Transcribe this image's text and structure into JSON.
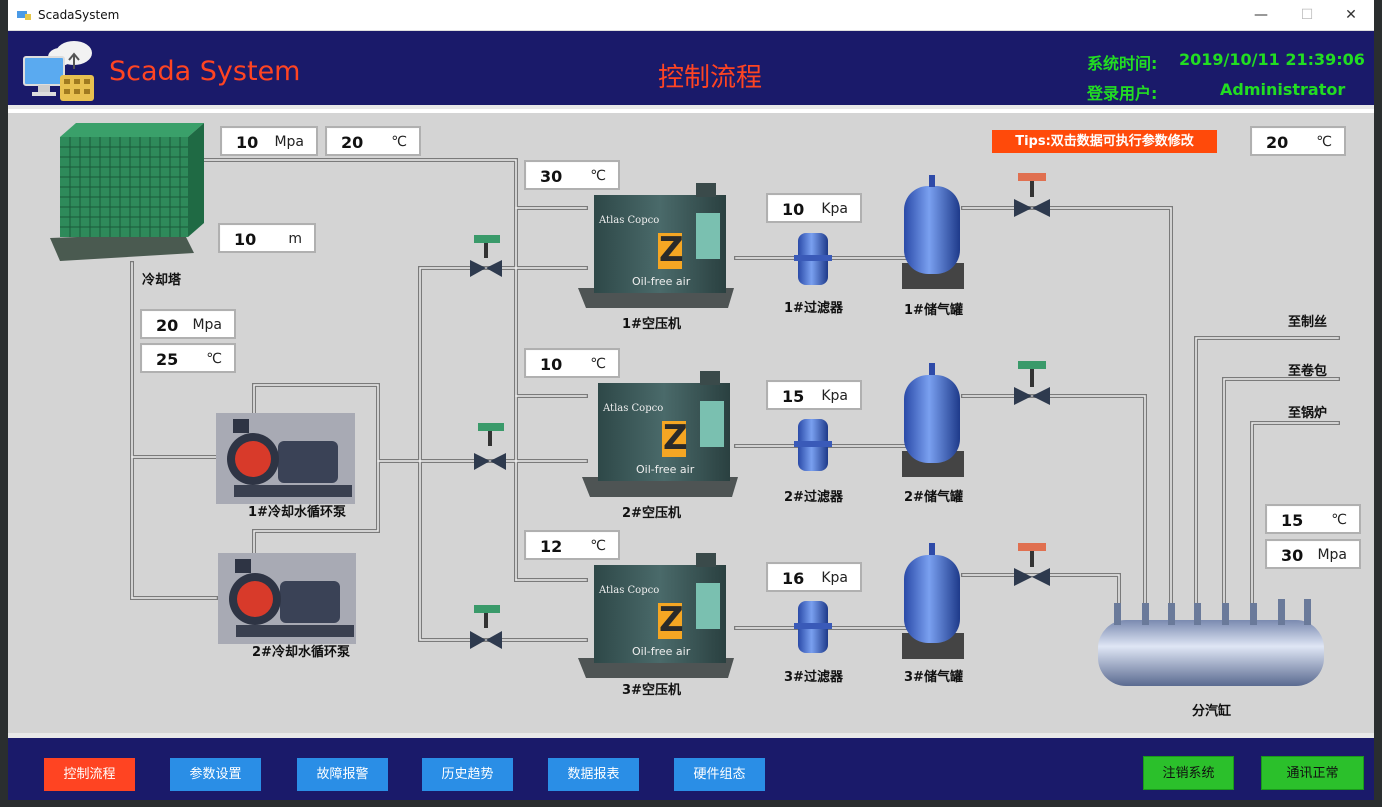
{
  "window": {
    "title": "ScadaSystem",
    "minimize": "—",
    "maximize": "☐",
    "close": "✕"
  },
  "header": {
    "app_name": "Scada System",
    "page_title": "控制流程",
    "time_label": "系统时间:",
    "time_value": "2019/10/11  21:39:06",
    "user_label": "登录用户:",
    "user_value": "Administrator"
  },
  "tips": "Tips:双击数据可执行参数修改",
  "cooling_tower": {
    "label": "冷却塔",
    "pressure": {
      "value": "10",
      "unit": "Mpa"
    },
    "temp": {
      "value": "20",
      "unit": "℃"
    },
    "level": {
      "value": "10",
      "unit": "m"
    }
  },
  "pump_inlet": {
    "pressure": {
      "value": "20",
      "unit": "Mpa"
    },
    "temp": {
      "value": "25",
      "unit": "℃"
    }
  },
  "pumps": [
    {
      "label": "1#冷却水循环泵"
    },
    {
      "label": "2#冷却水循环泵"
    }
  ],
  "compressors": [
    {
      "label": "1#空压机",
      "temp": {
        "value": "30",
        "unit": "℃"
      },
      "brand": "Atlas Copco",
      "badge": "Z",
      "tag": "Oil-free air"
    },
    {
      "label": "2#空压机",
      "temp": {
        "value": "10",
        "unit": "℃"
      },
      "brand": "Atlas Copco",
      "badge": "Z",
      "tag": "Oil-free air"
    },
    {
      "label": "3#空压机",
      "temp": {
        "value": "12",
        "unit": "℃"
      },
      "brand": "Atlas Copco",
      "badge": "Z",
      "tag": "Oil-free air"
    }
  ],
  "filters": [
    {
      "label": "1#过滤器",
      "pressure": {
        "value": "10",
        "unit": "Kpa"
      }
    },
    {
      "label": "2#过滤器",
      "pressure": {
        "value": "15",
        "unit": "Kpa"
      }
    },
    {
      "label": "3#过滤器",
      "pressure": {
        "value": "16",
        "unit": "Kpa"
      }
    }
  ],
  "tanks": [
    {
      "label": "1#储气罐"
    },
    {
      "label": "2#储气罐"
    },
    {
      "label": "3#储气罐"
    }
  ],
  "ambient_temp": {
    "value": "20",
    "unit": "℃"
  },
  "header_tank": {
    "label": "分汽缸",
    "temp": {
      "value": "15",
      "unit": "℃"
    },
    "pressure": {
      "value": "30",
      "unit": "Mpa"
    }
  },
  "outputs": [
    {
      "label": "至制丝"
    },
    {
      "label": "至卷包"
    },
    {
      "label": "至锅炉"
    }
  ],
  "nav": [
    {
      "label": "控制流程"
    },
    {
      "label": "参数设置"
    },
    {
      "label": "故障报警"
    },
    {
      "label": "历史趋势"
    },
    {
      "label": "数据报表"
    },
    {
      "label": "硬件组态"
    }
  ],
  "system_buttons": {
    "logout": "注销系统",
    "comm": "通讯正常"
  },
  "colors": {
    "header_bg": "#1a1a6a",
    "accent": "#ff4422",
    "info_green": "#22dd22",
    "nav_blue": "#2a8ee6",
    "sys_green": "#2bc02b",
    "canvas_bg": "#d4d4d4"
  }
}
